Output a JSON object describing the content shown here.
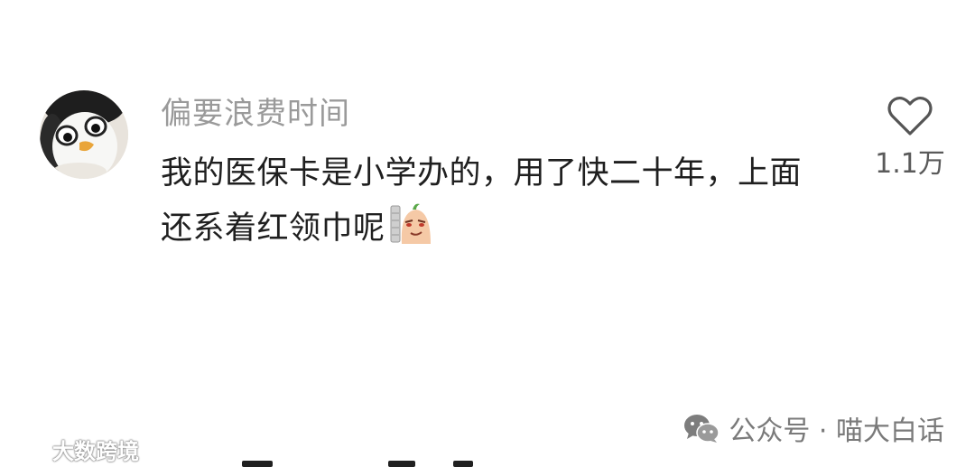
{
  "comment": {
    "username": "偏要浪费时间",
    "text": "我的医保卡是小学办的，用了快二十年，上面还系着红领巾呢",
    "avatar_icon": "penguin-plush-avatar",
    "sticker_icon": "smirking-bean-emoji",
    "like_icon": "heart-outline-icon",
    "like_count": "1.1万"
  },
  "footer": {
    "platform_icon": "wechat-icon",
    "brand": "公众号 · 喵大白话"
  },
  "watermark": {
    "text": "大数跨境"
  },
  "colors": {
    "background": "#ffffff",
    "username": "#9a9a9a",
    "text": "#1f1f1f",
    "like": "#5a5a5a"
  }
}
